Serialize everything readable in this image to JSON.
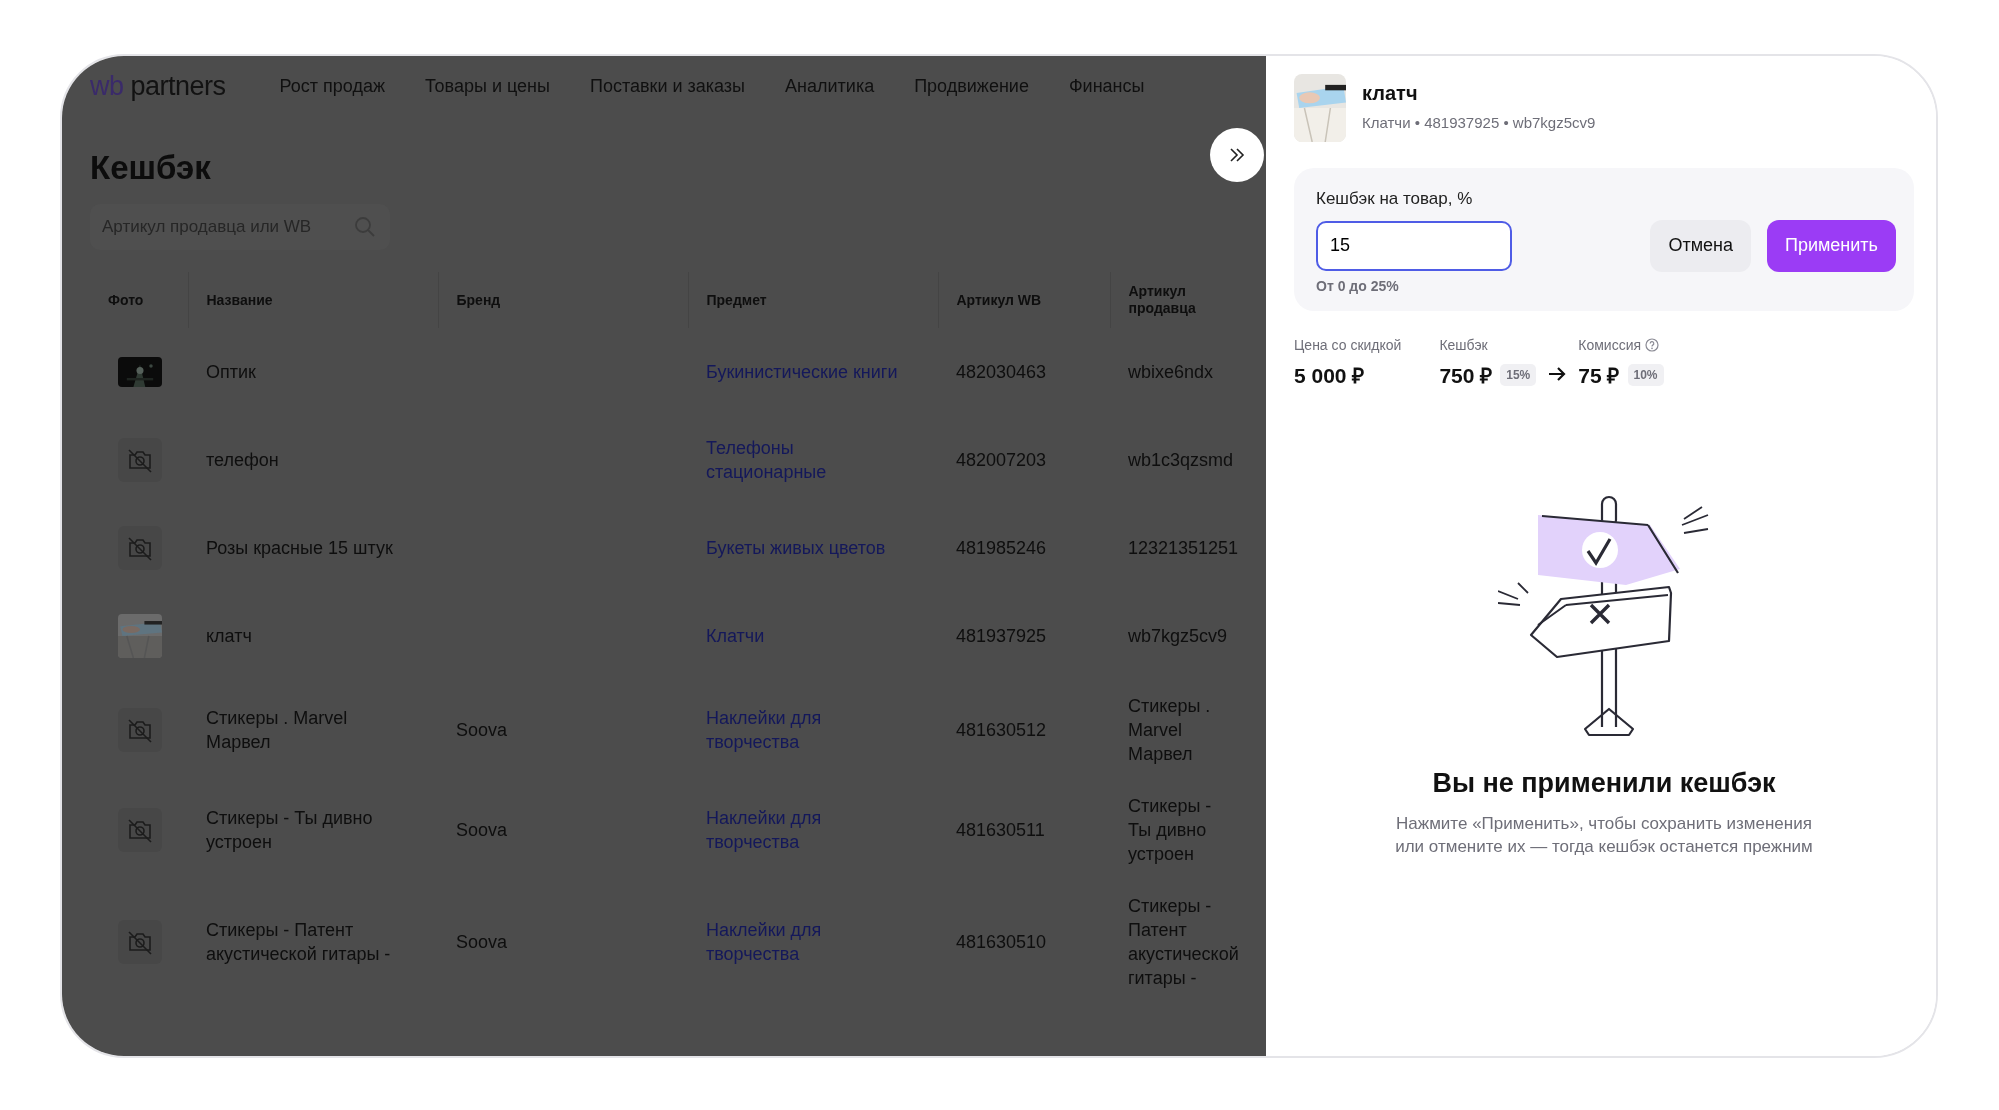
{
  "header": {
    "logo": {
      "mark": "wb",
      "text": "partners"
    },
    "nav": [
      {
        "label": "Рост продаж"
      },
      {
        "label": "Товары и цены"
      },
      {
        "label": "Поставки и заказы"
      },
      {
        "label": "Аналитика"
      },
      {
        "label": "Продвижение"
      },
      {
        "label": "Финансы"
      }
    ]
  },
  "page": {
    "title": "Кешбэк",
    "search": {
      "placeholder": "Артикул продавца или WB"
    }
  },
  "table": {
    "columns": [
      "Фото",
      "Название",
      "Бренд",
      "Предмет",
      "Артикул WB",
      "Артикул продавца"
    ],
    "rows": [
      {
        "kind": "picture",
        "name": "Оптик",
        "brand": "",
        "subject": "Букинистические книги",
        "article_wb": "482030463",
        "seller_article": "wbixe6ndx"
      },
      {
        "kind": "no-photo",
        "name": "телефон",
        "brand": "",
        "subject": "Телефоны стационарные",
        "article_wb": "482007203",
        "seller_article": "wb1c3qzsmd"
      },
      {
        "kind": "no-photo",
        "name": "Розы красные 15 штук",
        "brand": "",
        "subject": "Букеты живых цветов",
        "article_wb": "481985246",
        "seller_article": "12321351251"
      },
      {
        "kind": "picture",
        "name": "клатч",
        "brand": "",
        "subject": "Клатчи",
        "article_wb": "481937925",
        "seller_article": "wb7kgz5cv9"
      },
      {
        "kind": "no-photo",
        "name": "Стикеры . Marvel Марвел",
        "brand": "Soova",
        "subject": "Наклейки для творчества",
        "article_wb": "481630512",
        "seller_article": "Стикеры . Marvel Марвел"
      },
      {
        "kind": "no-photo",
        "name": "Стикеры - Ты дивно устроен",
        "brand": "Soova",
        "subject": "Наклейки для творчества",
        "article_wb": "481630511",
        "seller_article": "Стикеры - Ты дивно устроен"
      },
      {
        "kind": "no-photo",
        "name": "Стикеры - Патент акустической гитары -",
        "brand": "Soova",
        "subject": "Наклейки для творчества",
        "article_wb": "481630510",
        "seller_article": "Стикеры - Патент акустической гитары -"
      }
    ]
  },
  "panel": {
    "product": {
      "title": "клатч",
      "subtitle": "Клатчи • 481937925 • wb7kgz5cv9"
    },
    "form": {
      "label": "Кешбэк на товар, %",
      "value": "15",
      "hint": "От 0 до 25%",
      "buttons": [
        {
          "label": "Отмена",
          "kind": "secondary"
        },
        {
          "label": "Применить",
          "kind": "primary"
        }
      ]
    },
    "stats": [
      {
        "label": "Цена со скидкой",
        "value": "5 000 ₽",
        "arrow_before": false,
        "help": false
      },
      {
        "label": "Кешбэк",
        "value": "750 ₽",
        "badge": "15%",
        "arrow_before": false,
        "help": false
      },
      {
        "label": "Комиссия",
        "value": "75 ₽",
        "badge": "10%",
        "arrow_before": true,
        "help": true
      }
    ],
    "empty_state": {
      "title": "Вы не применили кешбэк",
      "text": "Нажмите «Применить», чтобы сохранить изменения\nили отмените их — тогда кешбэк останется прежним"
    }
  }
}
